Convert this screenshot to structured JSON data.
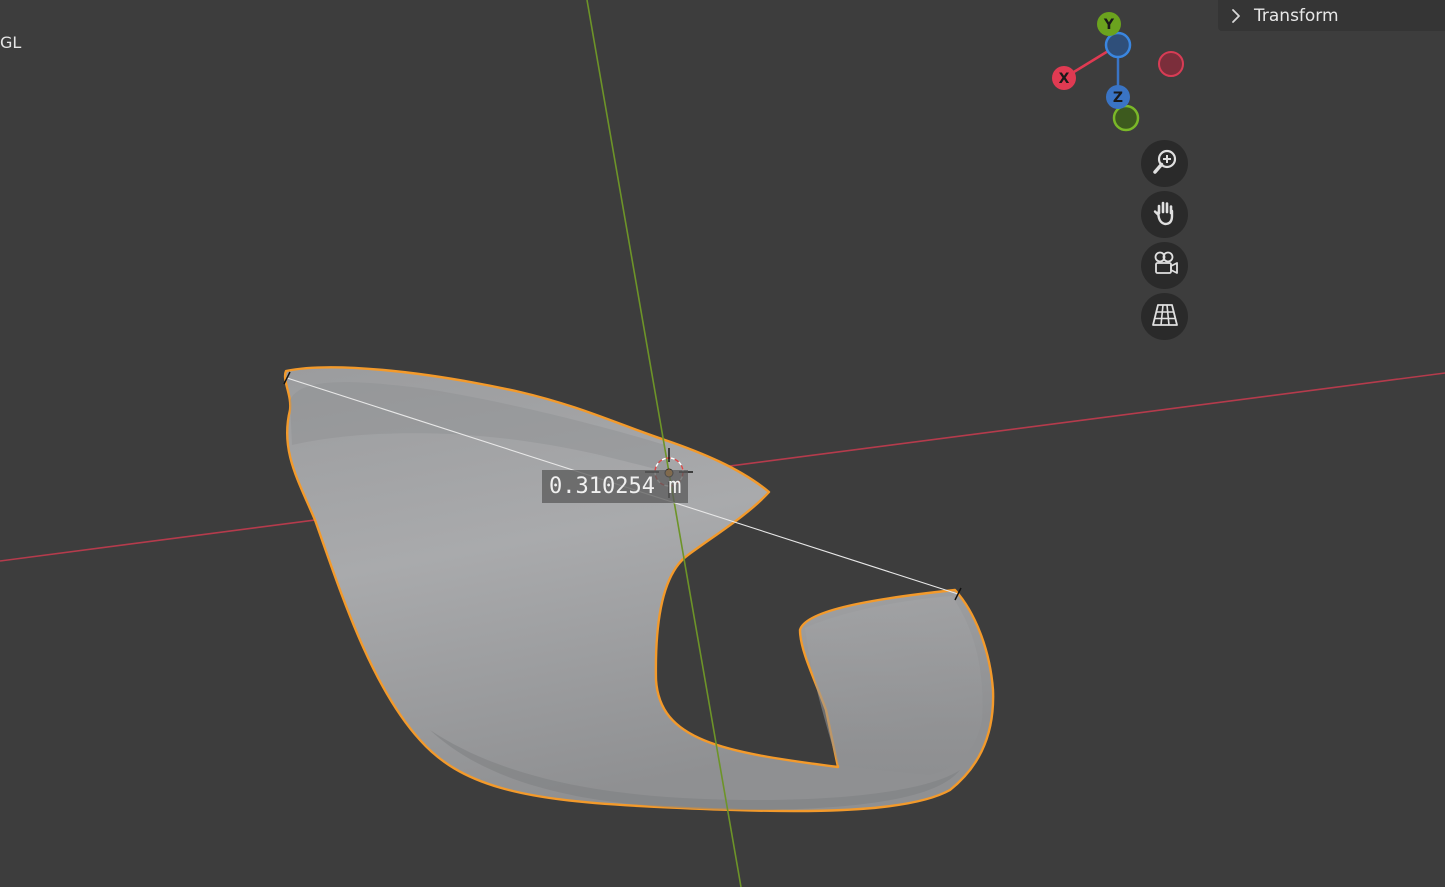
{
  "viewport": {
    "corner_label": "GL",
    "background_color": "#3d3d3d"
  },
  "sidebar": {
    "transform_header": {
      "label": "Transform",
      "icon": "chevron-right-icon",
      "expanded": false
    }
  },
  "navigation_gizmo": {
    "axes": [
      {
        "label": "Y",
        "color": "#6ba31e"
      },
      {
        "label": "X",
        "color": "#e03a52"
      },
      {
        "label": "Z",
        "color": "#3a74c4"
      }
    ],
    "buttons": [
      {
        "name": "zoom-button",
        "icon": "zoom-in-icon"
      },
      {
        "name": "pan-button",
        "icon": "hand-icon"
      },
      {
        "name": "camera-view-button",
        "icon": "camera-icon"
      },
      {
        "name": "perspective-toggle-button",
        "icon": "grid-icon"
      }
    ]
  },
  "measurement": {
    "label": "0.310254 m"
  },
  "colors": {
    "x_axis_line": "#b53b4c",
    "y_axis_line": "#6d9428",
    "selection_outline": "#f39a2b",
    "mesh_fill": "#a6a7a9",
    "measure_line": "#e8e8e8",
    "gizmo_y": "#6ba31e",
    "gizmo_x": "#e03a52",
    "gizmo_z": "#3a74c4"
  }
}
